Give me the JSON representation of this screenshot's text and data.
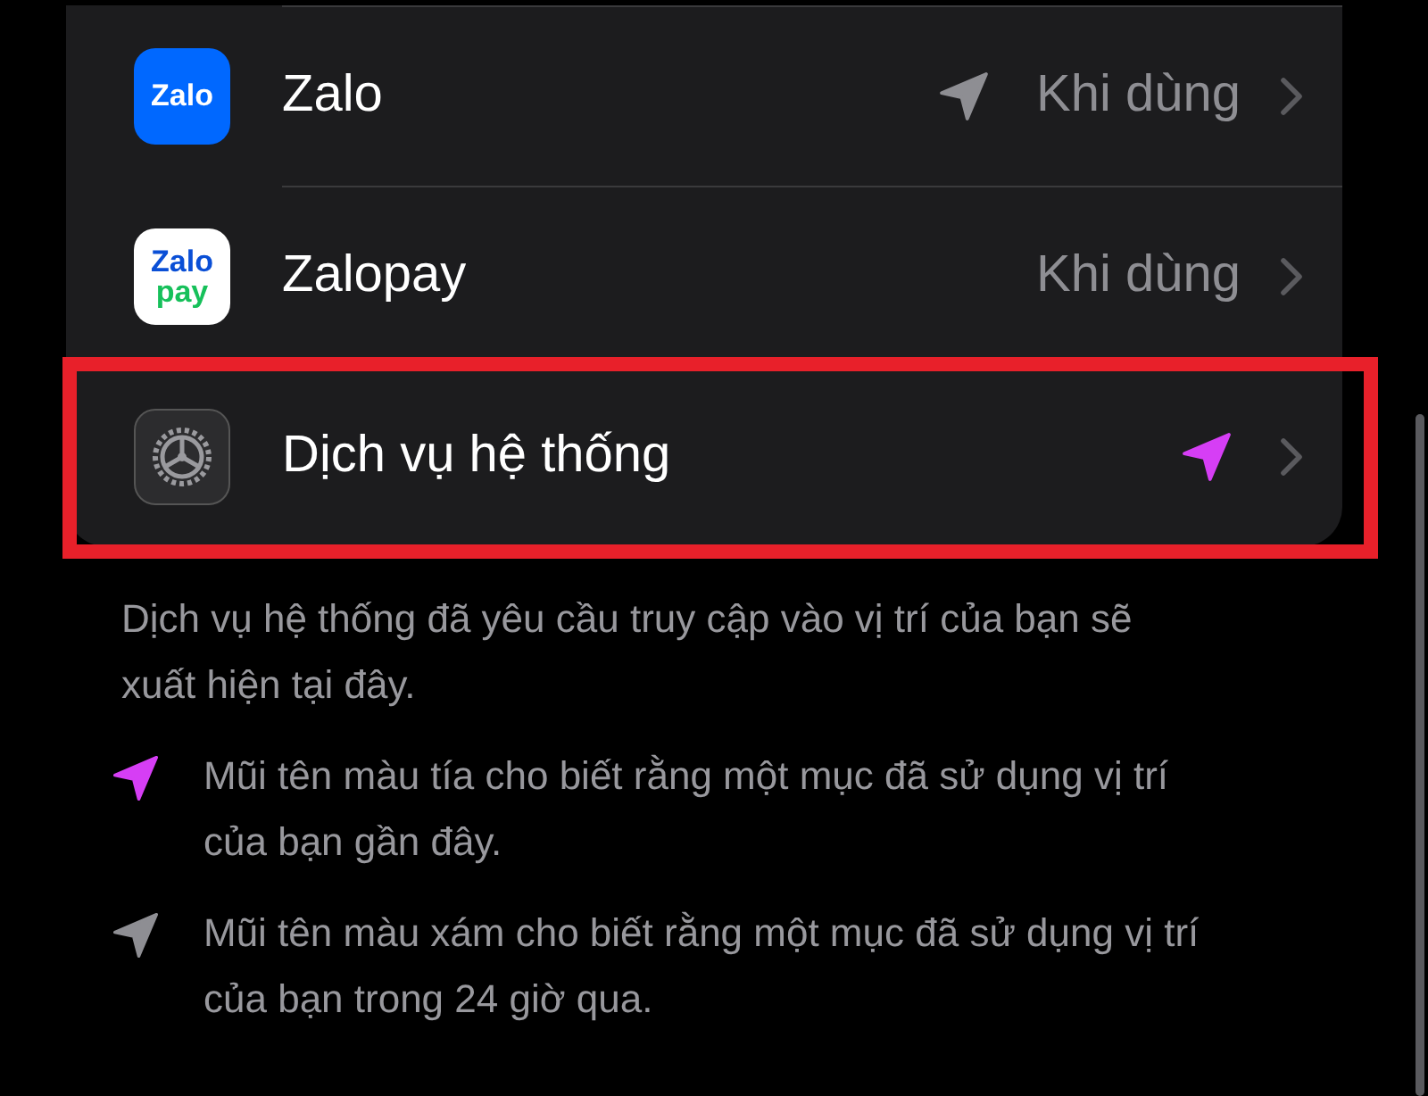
{
  "apps": [
    {
      "name": "Zalo",
      "kind": "zalo",
      "logo_lines": [
        "Zalo"
      ],
      "value": "Khi dùng",
      "color": "#8e8e93",
      "highlighted": false
    },
    {
      "name": "Zalopay",
      "kind": "zalopay",
      "logo_lines": [
        "Zalo",
        "pay"
      ],
      "value": "Khi dùng",
      "highlighted": false
    },
    {
      "name": "Dịch vụ hệ thống",
      "kind": "gear",
      "color": "#d63ef5",
      "highlighted": true
    }
  ],
  "footer": "Dịch vụ hệ thống đã yêu cầu truy cập vào vị trí của bạn sẽ xuất hiện tại đây.",
  "legend": [
    {
      "color": "#d63ef5",
      "text": "Mũi tên màu tía cho biết rằng một mục đã sử dụng vị trí của bạn gần đây."
    },
    {
      "color": "#8e8e93",
      "text": "Mũi tên màu xám cho biết rằng một mục đã sử dụng vị trí của bạn trong 24 giờ qua."
    }
  ]
}
